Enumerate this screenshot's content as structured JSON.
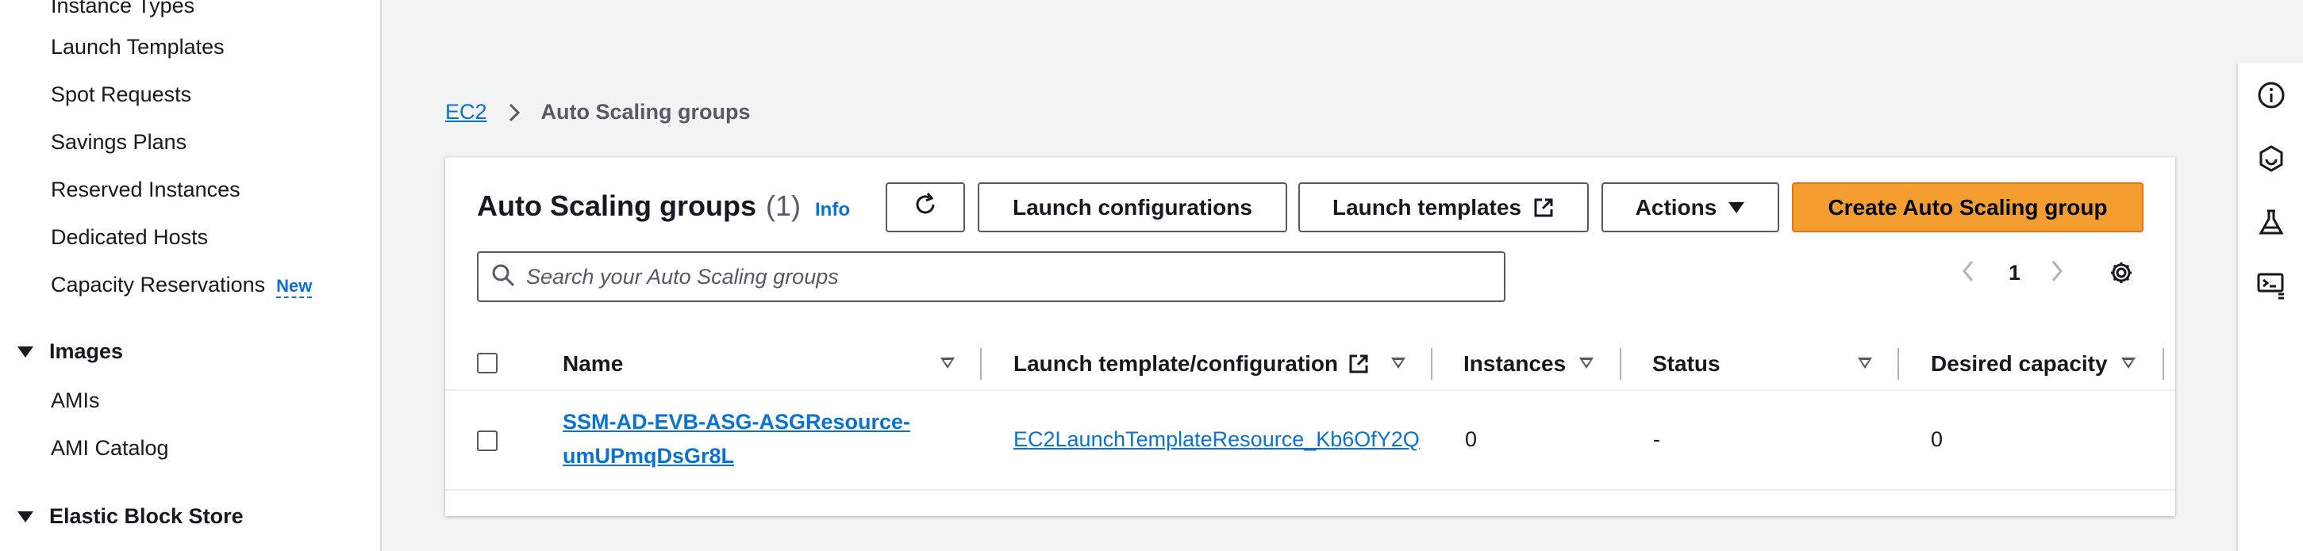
{
  "sidebar": {
    "items_top": [
      {
        "label": "Instance Types"
      },
      {
        "label": "Launch Templates"
      },
      {
        "label": "Spot Requests"
      },
      {
        "label": "Savings Plans"
      },
      {
        "label": "Reserved Instances"
      },
      {
        "label": "Dedicated Hosts"
      },
      {
        "label": "Capacity Reservations",
        "badge": "New"
      }
    ],
    "section_images": "Images",
    "items_images": [
      {
        "label": "AMIs"
      },
      {
        "label": "AMI Catalog"
      }
    ],
    "section_ebs": "Elastic Block Store"
  },
  "breadcrumb": {
    "root": "EC2",
    "current": "Auto Scaling groups"
  },
  "panel": {
    "title": "Auto Scaling groups",
    "count": "(1)",
    "info": "Info",
    "buttons": {
      "refresh_icon": "refresh-icon",
      "launch_configurations": "Launch configurations",
      "launch_templates": "Launch templates",
      "actions": "Actions",
      "create": "Create Auto Scaling group"
    },
    "search_placeholder": "Search your Auto Scaling groups",
    "page": "1"
  },
  "table": {
    "columns": [
      "Name",
      "Launch template/configuration",
      "Instances",
      "Status",
      "Desired capacity"
    ],
    "rows": [
      {
        "name_line1": "SSM-AD-EVB-ASG-ASGResource-",
        "name_line2": "umUPmqDsGr8L",
        "launch_template": "EC2LaunchTemplateResource_Kb6OfY2Q",
        "instances": "0",
        "status": "-",
        "desired_capacity": "0"
      }
    ]
  },
  "rail_icons": [
    "info-icon",
    "feedback-icon",
    "lab-icon",
    "console-icon"
  ]
}
